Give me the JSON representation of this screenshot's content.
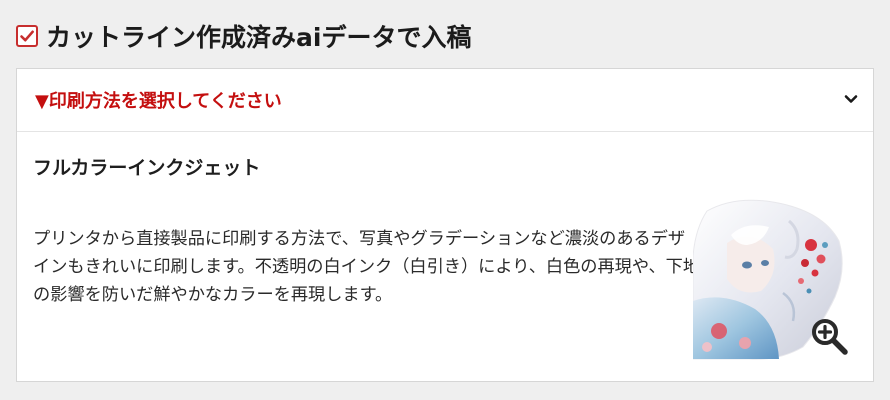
{
  "upload_option": {
    "checked": true,
    "label": "カットライン作成済みaiデータで入稿"
  },
  "print_method": {
    "select_placeholder": "▼印刷方法を選択してください",
    "selected_method": "フルカラーインクジェット",
    "description": "プリンタから直接製品に印刷する方法で、写真やグラデーションなど濃淡のあるデザインもきれいに印刷します。不透明の白インク（白引き）により、白色の再現や、下地の影響を防いだ鮮やかなカラーを再現します。"
  },
  "icons": {
    "checkbox": "checkmark-icon",
    "dropdown": "chevron-down-icon",
    "zoom": "zoom-in-icon"
  },
  "colors": {
    "accent_red": "#c40f0f",
    "checkbox_border": "#c72e2e",
    "background": "#efefef"
  }
}
